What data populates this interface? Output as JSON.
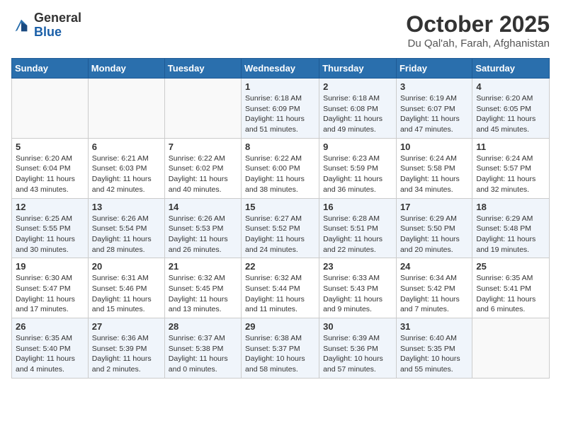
{
  "header": {
    "logo_general": "General",
    "logo_blue": "Blue",
    "month_title": "October 2025",
    "location": "Du Qal'ah, Farah, Afghanistan"
  },
  "weekdays": [
    "Sunday",
    "Monday",
    "Tuesday",
    "Wednesday",
    "Thursday",
    "Friday",
    "Saturday"
  ],
  "weeks": [
    [
      {
        "day": "",
        "info": ""
      },
      {
        "day": "",
        "info": ""
      },
      {
        "day": "",
        "info": ""
      },
      {
        "day": "1",
        "info": "Sunrise: 6:18 AM\nSunset: 6:09 PM\nDaylight: 11 hours\nand 51 minutes."
      },
      {
        "day": "2",
        "info": "Sunrise: 6:18 AM\nSunset: 6:08 PM\nDaylight: 11 hours\nand 49 minutes."
      },
      {
        "day": "3",
        "info": "Sunrise: 6:19 AM\nSunset: 6:07 PM\nDaylight: 11 hours\nand 47 minutes."
      },
      {
        "day": "4",
        "info": "Sunrise: 6:20 AM\nSunset: 6:05 PM\nDaylight: 11 hours\nand 45 minutes."
      }
    ],
    [
      {
        "day": "5",
        "info": "Sunrise: 6:20 AM\nSunset: 6:04 PM\nDaylight: 11 hours\nand 43 minutes."
      },
      {
        "day": "6",
        "info": "Sunrise: 6:21 AM\nSunset: 6:03 PM\nDaylight: 11 hours\nand 42 minutes."
      },
      {
        "day": "7",
        "info": "Sunrise: 6:22 AM\nSunset: 6:02 PM\nDaylight: 11 hours\nand 40 minutes."
      },
      {
        "day": "8",
        "info": "Sunrise: 6:22 AM\nSunset: 6:00 PM\nDaylight: 11 hours\nand 38 minutes."
      },
      {
        "day": "9",
        "info": "Sunrise: 6:23 AM\nSunset: 5:59 PM\nDaylight: 11 hours\nand 36 minutes."
      },
      {
        "day": "10",
        "info": "Sunrise: 6:24 AM\nSunset: 5:58 PM\nDaylight: 11 hours\nand 34 minutes."
      },
      {
        "day": "11",
        "info": "Sunrise: 6:24 AM\nSunset: 5:57 PM\nDaylight: 11 hours\nand 32 minutes."
      }
    ],
    [
      {
        "day": "12",
        "info": "Sunrise: 6:25 AM\nSunset: 5:55 PM\nDaylight: 11 hours\nand 30 minutes."
      },
      {
        "day": "13",
        "info": "Sunrise: 6:26 AM\nSunset: 5:54 PM\nDaylight: 11 hours\nand 28 minutes."
      },
      {
        "day": "14",
        "info": "Sunrise: 6:26 AM\nSunset: 5:53 PM\nDaylight: 11 hours\nand 26 minutes."
      },
      {
        "day": "15",
        "info": "Sunrise: 6:27 AM\nSunset: 5:52 PM\nDaylight: 11 hours\nand 24 minutes."
      },
      {
        "day": "16",
        "info": "Sunrise: 6:28 AM\nSunset: 5:51 PM\nDaylight: 11 hours\nand 22 minutes."
      },
      {
        "day": "17",
        "info": "Sunrise: 6:29 AM\nSunset: 5:50 PM\nDaylight: 11 hours\nand 20 minutes."
      },
      {
        "day": "18",
        "info": "Sunrise: 6:29 AM\nSunset: 5:48 PM\nDaylight: 11 hours\nand 19 minutes."
      }
    ],
    [
      {
        "day": "19",
        "info": "Sunrise: 6:30 AM\nSunset: 5:47 PM\nDaylight: 11 hours\nand 17 minutes."
      },
      {
        "day": "20",
        "info": "Sunrise: 6:31 AM\nSunset: 5:46 PM\nDaylight: 11 hours\nand 15 minutes."
      },
      {
        "day": "21",
        "info": "Sunrise: 6:32 AM\nSunset: 5:45 PM\nDaylight: 11 hours\nand 13 minutes."
      },
      {
        "day": "22",
        "info": "Sunrise: 6:32 AM\nSunset: 5:44 PM\nDaylight: 11 hours\nand 11 minutes."
      },
      {
        "day": "23",
        "info": "Sunrise: 6:33 AM\nSunset: 5:43 PM\nDaylight: 11 hours\nand 9 minutes."
      },
      {
        "day": "24",
        "info": "Sunrise: 6:34 AM\nSunset: 5:42 PM\nDaylight: 11 hours\nand 7 minutes."
      },
      {
        "day": "25",
        "info": "Sunrise: 6:35 AM\nSunset: 5:41 PM\nDaylight: 11 hours\nand 6 minutes."
      }
    ],
    [
      {
        "day": "26",
        "info": "Sunrise: 6:35 AM\nSunset: 5:40 PM\nDaylight: 11 hours\nand 4 minutes."
      },
      {
        "day": "27",
        "info": "Sunrise: 6:36 AM\nSunset: 5:39 PM\nDaylight: 11 hours\nand 2 minutes."
      },
      {
        "day": "28",
        "info": "Sunrise: 6:37 AM\nSunset: 5:38 PM\nDaylight: 11 hours\nand 0 minutes."
      },
      {
        "day": "29",
        "info": "Sunrise: 6:38 AM\nSunset: 5:37 PM\nDaylight: 10 hours\nand 58 minutes."
      },
      {
        "day": "30",
        "info": "Sunrise: 6:39 AM\nSunset: 5:36 PM\nDaylight: 10 hours\nand 57 minutes."
      },
      {
        "day": "31",
        "info": "Sunrise: 6:40 AM\nSunset: 5:35 PM\nDaylight: 10 hours\nand 55 minutes."
      },
      {
        "day": "",
        "info": ""
      }
    ]
  ]
}
